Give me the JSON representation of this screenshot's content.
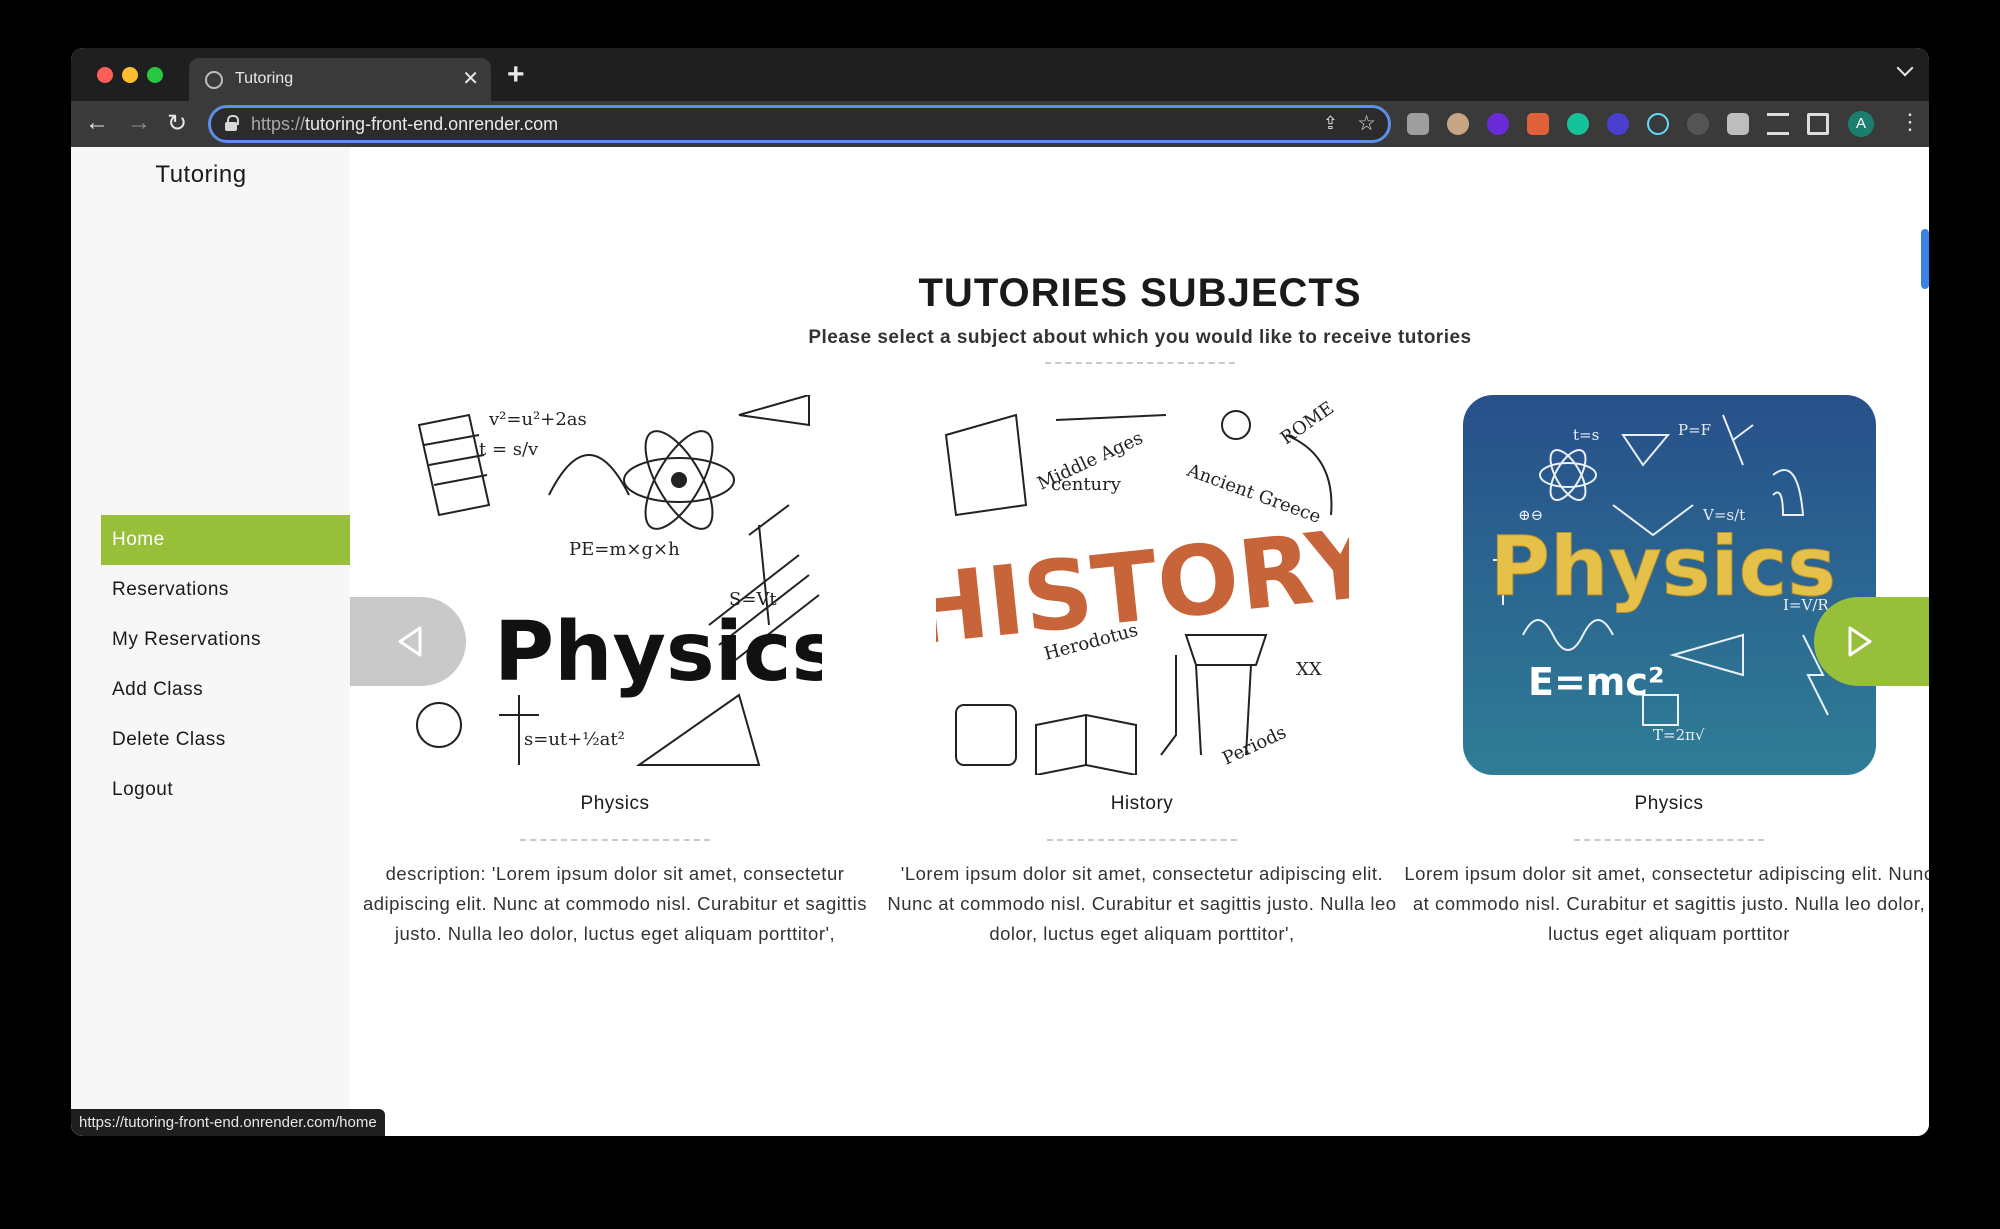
{
  "browser": {
    "tab_title": "Tutoring",
    "url_protocol": "https://",
    "url_host": "tutoring-front-end.onrender.com",
    "avatar_initial": "A",
    "status_url": "https://tutoring-front-end.onrender.com/home"
  },
  "sidebar": {
    "brand": "Tutoring",
    "items": [
      {
        "label": "Home",
        "active": true
      },
      {
        "label": "Reservations"
      },
      {
        "label": "My Reservations"
      },
      {
        "label": "Add Class"
      },
      {
        "label": "Delete Class"
      },
      {
        "label": "Logout"
      }
    ]
  },
  "main": {
    "heading": "TUTORIES SUBJECTS",
    "subheading": "Please select a subject about which you would like to receive tutories",
    "cards": [
      {
        "image_title": "Physics",
        "name": "Physics",
        "description": "description: 'Lorem ipsum dolor sit amet, consectetur adipiscing elit. Nunc at commodo nisl. Curabitur et sagittis justo. Nulla leo dolor, luctus eget aliquam porttitor',"
      },
      {
        "image_title": "HISTORY",
        "name": "History",
        "description": "'Lorem ipsum dolor sit amet, consectetur adipiscing elit. Nunc at commodo nisl. Curabitur et sagittis justo. Nulla leo dolor, luctus eget aliquam porttitor',"
      },
      {
        "image_title": "Physics",
        "name": "Physics",
        "description": "Lorem ipsum dolor sit amet, consectetur adipiscing elit. Nunc at commodo nisl. Curabitur et sagittis justo. Nulla leo dolor, luctus eget aliquam porttitor"
      }
    ]
  },
  "colors": {
    "accent": "#97bf3a",
    "arrow_disabled": "#c9c9c9",
    "history_orange": "#c8643a"
  }
}
